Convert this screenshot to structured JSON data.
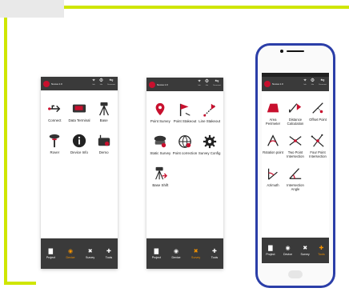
{
  "screens": [
    {
      "app_title": "Nuova 1.0",
      "tray": [
        {
          "icon": "gps-icon",
          "label": "Info"
        },
        {
          "icon": "settings-icon",
          "label": "Info"
        },
        {
          "icon": "usb-icon",
          "label": "Disconnect"
        }
      ],
      "tiles": [
        {
          "icon": "usb-icon",
          "label": "Connect"
        },
        {
          "icon": "data-terminal-icon",
          "label": "Data Terminal"
        },
        {
          "icon": "tripod-icon",
          "label": "Base"
        },
        {
          "icon": "rover-icon",
          "label": "Rover"
        },
        {
          "icon": "info-icon",
          "label": "Device Info"
        },
        {
          "icon": "radio-icon",
          "label": "Demo"
        }
      ],
      "nav": [
        {
          "icon": "folder-icon",
          "label": "Project",
          "active": false
        },
        {
          "icon": "device-icon",
          "label": "Device",
          "active": true
        },
        {
          "icon": "survey-icon",
          "label": "Survey",
          "active": false
        },
        {
          "icon": "tools-icon",
          "label": "Tools",
          "active": false
        }
      ]
    },
    {
      "app_title": "Nuova 1.0",
      "tray": [
        {
          "icon": "gps-icon",
          "label": "Info"
        },
        {
          "icon": "settings-icon",
          "label": "Info"
        },
        {
          "icon": "usb-icon",
          "label": "Disconnect"
        }
      ],
      "tiles": [
        {
          "icon": "pin-icon",
          "label": "Point Survey"
        },
        {
          "icon": "flag-icon",
          "label": "Point Stakeout"
        },
        {
          "icon": "line-stakeout-icon",
          "label": "Line Stakeout"
        },
        {
          "icon": "static-icon",
          "label": "Static Survey"
        },
        {
          "icon": "globe-icon",
          "label": "Point correction"
        },
        {
          "icon": "gear-icon",
          "label": "Survey Config"
        },
        {
          "icon": "base-shift-icon",
          "label": "Base Shift"
        }
      ],
      "nav": [
        {
          "icon": "folder-icon",
          "label": "Project",
          "active": false
        },
        {
          "icon": "device-icon",
          "label": "Device",
          "active": false
        },
        {
          "icon": "survey-icon",
          "label": "Survey",
          "active": true
        },
        {
          "icon": "tools-icon",
          "label": "Tools",
          "active": false
        }
      ]
    },
    {
      "app_title": "Nuova 1.0",
      "tray": [
        {
          "icon": "gps-icon",
          "label": "Info"
        },
        {
          "icon": "settings-icon",
          "label": "Info"
        },
        {
          "icon": "usb-icon",
          "label": "Disconnect"
        }
      ],
      "tiles": [
        {
          "icon": "area-icon",
          "label": "Area Perimeter"
        },
        {
          "icon": "distance-icon",
          "label": "Distance Calculation"
        },
        {
          "icon": "offset-icon",
          "label": "Offset Point"
        },
        {
          "icon": "rotation-icon",
          "label": "Rotation point"
        },
        {
          "icon": "intersection-icon",
          "label": "Two Point Intersection"
        },
        {
          "icon": "four-point-icon",
          "label": "Four Point Intersection"
        },
        {
          "icon": "azimuth-icon",
          "label": "Azimuth"
        },
        {
          "icon": "angle-icon",
          "label": "Intersection Angle"
        }
      ],
      "nav": [
        {
          "icon": "folder-icon",
          "label": "Project",
          "active": false
        },
        {
          "icon": "device-icon",
          "label": "Device",
          "active": false
        },
        {
          "icon": "survey-icon",
          "label": "Survey",
          "active": false
        },
        {
          "icon": "tools-icon",
          "label": "Tools",
          "active": true
        }
      ]
    }
  ],
  "glyphs": {
    "gps-icon": "⌖",
    "settings-icon": "⚙",
    "usb-icon": "⇋",
    "folder-icon": "▇",
    "device-icon": "◉",
    "survey-icon": "✖",
    "tools-icon": "✚"
  },
  "colors": {
    "accent": "#c8102e",
    "nav_active": "#f39200",
    "frame": "#cfe600",
    "phone_body": "#2b3ea8"
  }
}
